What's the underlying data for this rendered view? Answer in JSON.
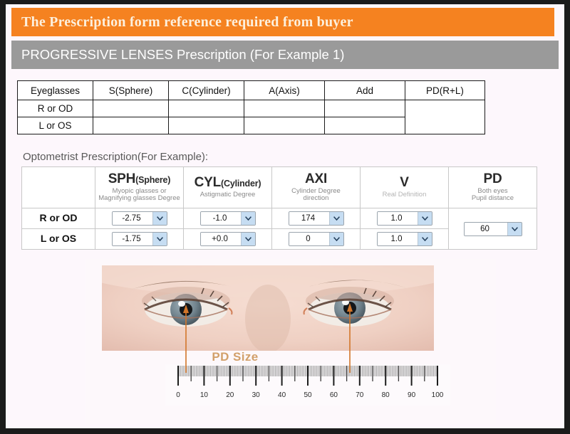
{
  "header": {
    "title": "The Prescription form reference required from buyer",
    "subtitle": "PROGRESSIVE LENSES Prescription (For Example 1)",
    "title_bar_color": "#f58220",
    "sub_bar_color": "#9a9a9a"
  },
  "blank_table": {
    "columns": [
      "Eyeglasses",
      "S(Sphere)",
      "C(Cylinder)",
      "A(Axis)",
      "Add",
      "PD(R+L)"
    ],
    "rows": [
      {
        "label": "R or OD",
        "values": [
          "",
          "",
          "",
          ""
        ]
      },
      {
        "label": "L or OS",
        "values": [
          "",
          "",
          "",
          ""
        ]
      }
    ],
    "pd_merged_value": ""
  },
  "example_table": {
    "caption": "Optometrist Prescription(For Example):",
    "columns": [
      {
        "main": "",
        "small": "",
        "sub": ""
      },
      {
        "main": "SPH",
        "small": "(Sphere)",
        "sub": "Myopic glasses or\nMagnifying glasses Degree"
      },
      {
        "main": "CYL",
        "small": "(Cylinder)",
        "sub": "Astigmatic  Degree"
      },
      {
        "main": "AXI",
        "small": "",
        "sub": "Cylinder Degree\ndirection"
      },
      {
        "main": "V",
        "small": "",
        "sub": "Real Definition"
      },
      {
        "main": "PD",
        "small": "",
        "sub": "Both eyes\nPupil distance"
      }
    ],
    "rows": [
      {
        "label": "R or OD",
        "sph": "-2.75",
        "cyl": "-1.0",
        "axi": "174",
        "v": "1.0"
      },
      {
        "label": "L or OS",
        "sph": "-1.75",
        "cyl": "+0.0",
        "axi": "0",
        "v": "1.0"
      }
    ],
    "pd_value": "60"
  },
  "illustration": {
    "pd_size_label": "PD Size",
    "ruler": {
      "min": 0,
      "max": 100,
      "major_step": 10,
      "labels": [
        "0",
        "10",
        "20",
        "30",
        "40",
        "50",
        "60",
        "70",
        "80",
        "90",
        "100"
      ]
    },
    "arrow_color": "#d2762a",
    "left_pupil_mark": 0,
    "right_pupil_mark": 57
  }
}
